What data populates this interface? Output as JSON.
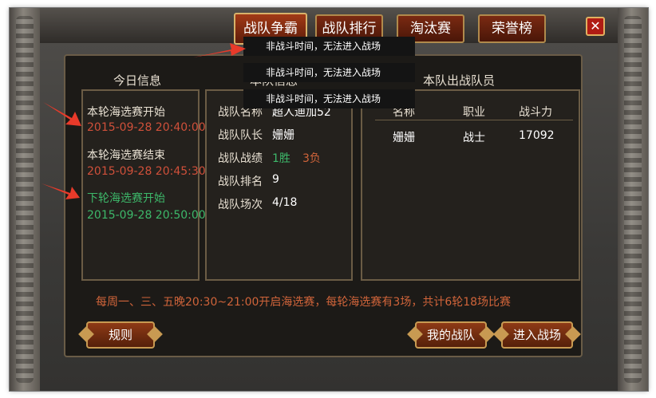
{
  "tabs": [
    {
      "label": "战队争霸",
      "active": true
    },
    {
      "label": "战队排行",
      "active": false
    },
    {
      "label": "淘汰赛",
      "active": false
    },
    {
      "label": "荣誉榜",
      "active": false
    }
  ],
  "close_label": "✕",
  "today_info": {
    "title": "今日信息",
    "items": [
      {
        "label": "本轮海选赛开始",
        "time": "2015-09-28 20:40:00"
      },
      {
        "label": "本轮海选赛结束",
        "time": "2015-09-28 20:45:30"
      },
      {
        "label": "下轮海选赛开始",
        "time": "2015-09-28 20:50:00"
      }
    ]
  },
  "team_info": {
    "title": "本队信息",
    "name_label": "战队名称",
    "name_value": "超人迪加52",
    "captain_label": "战队队长",
    "captain_value": "姗姗",
    "record_label": "战队战绩",
    "wins": "1胜",
    "losses": "3负",
    "rank_label": "战队排名",
    "rank_value": "9",
    "matches_label": "战队场次",
    "matches_value": "4/18"
  },
  "roster": {
    "title": "本队出战队员",
    "headers": [
      "名称",
      "职业",
      "战斗力"
    ],
    "rows": [
      {
        "name": "姗姗",
        "class": "战士",
        "power": "17092"
      }
    ]
  },
  "tooltips": [
    "非战斗时间，无法进入战场",
    "非战斗时间，无法进入战场",
    "非战斗时间，无法进入战场"
  ],
  "notice": "每周一、三、五晚20:30~21:00开启海选赛，每轮海选赛有3场，共计6轮18场比赛",
  "buttons": {
    "rules": "规则",
    "my_team": "我的战队",
    "enter_battle": "进入战场"
  },
  "colors": {
    "time_current": "#d0503a",
    "time_next": "#3db86a",
    "label_next": "#3db86a",
    "wins": "#3db86a",
    "losses": "#d0643a",
    "arrow": "#e83a2a"
  }
}
